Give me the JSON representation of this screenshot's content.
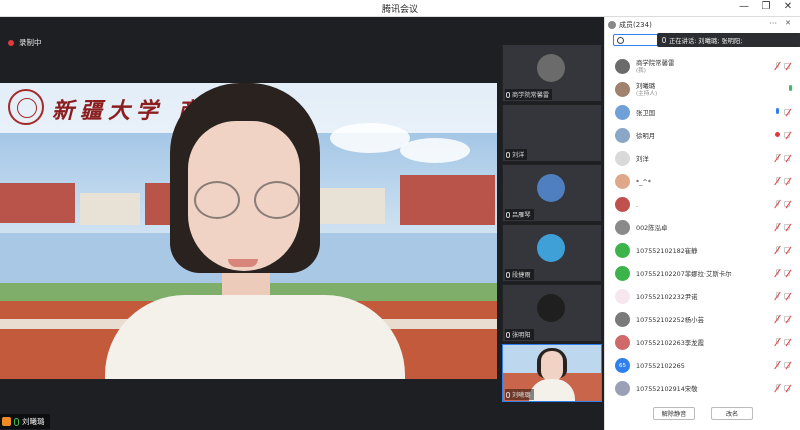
{
  "window": {
    "title": "腾讯会议",
    "controls": [
      "—",
      "❐",
      "✕"
    ]
  },
  "meeting": {
    "recording_label": "录制中",
    "main_speaker_name": "刘曦璐"
  },
  "campus_banner_text": "新疆大学 商",
  "thumbnails": [
    {
      "name": "商学院常馨雷",
      "avatar_color": "#6b6b6b"
    },
    {
      "name": "刘洋",
      "avatar_color": "#3a3c40"
    },
    {
      "name": "吕雁琴",
      "avatar_color": "#4f7fbf"
    },
    {
      "name": "段捷雨",
      "avatar_color": "#3fa0d8"
    },
    {
      "name": "张明阳",
      "avatar_color": "#1f1f1f"
    },
    {
      "name": "刘曦璐",
      "avatar_color": "#f0d3c4"
    }
  ],
  "panel": {
    "title": "成员(234)",
    "more": "···",
    "pin": "✕",
    "speaking_text": "正在讲话: 刘曦璐; 张明阳;",
    "mute_all_label": "解除静音",
    "rename_label": "改名",
    "members": [
      {
        "name": "商学院常馨雷",
        "sub": "(我)",
        "avatar_color": "#6b6b6b",
        "mic": "off",
        "cam": true
      },
      {
        "name": "刘曦璐",
        "sub": "(主持人)",
        "avatar_color": "#a0826d",
        "mic": "on",
        "cam": false
      },
      {
        "name": "张卫国",
        "sub": "",
        "avatar_color": "#6fa0d8",
        "mic": "blue",
        "cam": true
      },
      {
        "name": "徐明月",
        "sub": "",
        "avatar_color": "#8aa7c7",
        "mic": "red",
        "cam": true
      },
      {
        "name": "刘洋",
        "sub": "",
        "avatar_color": "#d9d9d9",
        "mic": "off",
        "cam": true
      },
      {
        "name": "*_^*",
        "sub": "",
        "avatar_color": "#e0a88a",
        "mic": "off",
        "cam": true
      },
      {
        "name": ".",
        "sub": "",
        "avatar_color": "#c0504d",
        "mic": "off",
        "cam": true
      },
      {
        "name": "002陈泓卓",
        "sub": "",
        "avatar_color": "#8a8a8a",
        "mic": "off",
        "cam": true
      },
      {
        "name": "107552102182崔静",
        "sub": "",
        "avatar_color": "#3cb44b",
        "mic": "off",
        "cam": true
      },
      {
        "name": "107552102207菲娜拉·艾斯卡尔",
        "sub": "",
        "avatar_color": "#3cb44b",
        "mic": "off",
        "cam": true
      },
      {
        "name": "107552102232尹诺",
        "sub": "",
        "avatar_color": "#f5e6ef",
        "mic": "off",
        "cam": true
      },
      {
        "name": "107552102252杨小芸",
        "sub": "",
        "avatar_color": "#7a7a7a",
        "mic": "off",
        "cam": true
      },
      {
        "name": "107552102263李龙霞",
        "sub": "",
        "avatar_color": "#d06a6a",
        "mic": "off",
        "cam": true
      },
      {
        "name": "107552102265",
        "sub": "",
        "avatar_color": "#2f80ed",
        "avatar_text": "65",
        "mic": "off",
        "cam": true
      },
      {
        "name": "107552102914宋敬",
        "sub": "",
        "avatar_color": "#9aa0b5",
        "mic": "off",
        "cam": true
      }
    ]
  }
}
